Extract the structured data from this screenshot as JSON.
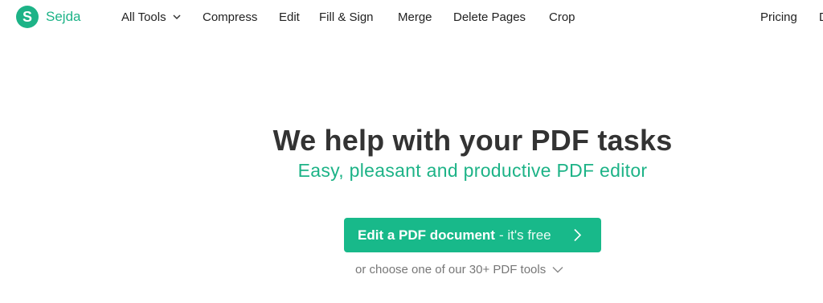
{
  "brand": {
    "logo_letter": "S",
    "name": "Sejda",
    "color": "#1db387"
  },
  "nav": {
    "items": [
      {
        "label": "All Tools",
        "icon": "chevron-down-icon"
      },
      {
        "label": "Compress"
      },
      {
        "label": "Edit"
      },
      {
        "label": "Fill & Sign"
      },
      {
        "label": "Merge"
      },
      {
        "label": "Delete Pages"
      },
      {
        "label": "Crop"
      }
    ],
    "right": {
      "pricing": "Pricing",
      "truncated": "D"
    }
  },
  "hero": {
    "title": "We help with your PDF tasks",
    "subtitle": "Easy, pleasant and productive PDF editor"
  },
  "cta": {
    "bold_text": "Edit a PDF document",
    "light_text": "- it's free",
    "icon": "chevron-right-icon",
    "color": "#18b98a"
  },
  "more": {
    "text": "or choose one of our 30+ PDF tools",
    "icon": "chevron-down-icon"
  }
}
